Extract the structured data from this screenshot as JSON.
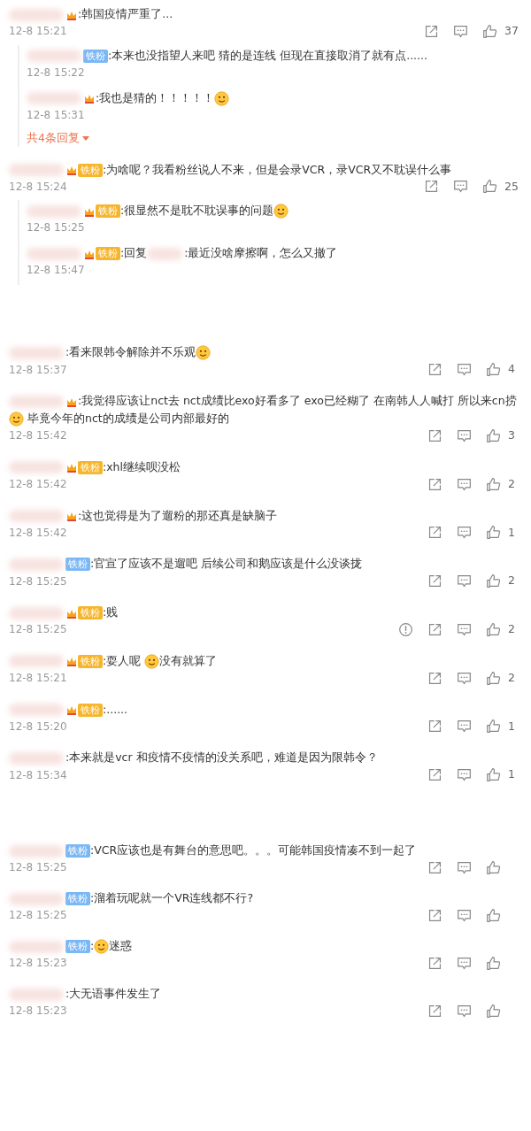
{
  "comments": [
    {
      "badge": {
        "kind": "crown"
      },
      "parts": [
        {
          "kind": "text",
          "text": ":韩国疫情严重了..."
        }
      ],
      "time": "12-8 15:21",
      "likes": "37",
      "replies": [
        {
          "badge": {
            "kind": "blue",
            "label": "铁粉"
          },
          "parts": [
            {
              "kind": "text",
              "text": ":本来也没指望人来吧 猜的是连线 但现在直接取消了就有点......"
            }
          ],
          "time": "12-8 15:22"
        },
        {
          "badge": {
            "kind": "crown"
          },
          "parts": [
            {
              "kind": "text",
              "text": ":我也是猜的！！！！！"
            },
            {
              "kind": "emoji"
            }
          ],
          "time": "12-8 15:31"
        }
      ],
      "more_link": "共4条回复"
    },
    {
      "badge": {
        "kind": "gold",
        "label": "铁粉"
      },
      "parts": [
        {
          "kind": "text",
          "text": ":为啥呢？我看粉丝说人不来，但是会录VCR，录VCR又不耽误什么事"
        }
      ],
      "time": "12-8 15:24",
      "likes": "25",
      "replies": [
        {
          "badge": {
            "kind": "gold",
            "label": "铁粉"
          },
          "parts": [
            {
              "kind": "text",
              "text": ":很显然不是耽不耽误事的问题"
            },
            {
              "kind": "emoji"
            }
          ],
          "time": "12-8 15:25"
        },
        {
          "badge": {
            "kind": "gold",
            "label": "铁粉"
          },
          "parts": [
            {
              "kind": "text",
              "text": ":回复"
            },
            {
              "kind": "hidden"
            },
            {
              "kind": "text",
              "text": ":最近没啥摩擦啊，怎么又撤了"
            }
          ],
          "time": "12-8 15:47"
        }
      ]
    },
    {
      "parts": [
        {
          "kind": "text",
          "text": ":看来限韩令解除并不乐观"
        },
        {
          "kind": "emoji"
        }
      ],
      "time": "12-8 15:37",
      "likes": "4"
    },
    {
      "badge": {
        "kind": "crown"
      },
      "parts": [
        {
          "kind": "text",
          "text": ":我觉得应该让nct去 nct成绩比exo好看多了 exo已经糊了 在南韩人人喊打 所以来cn捞"
        },
        {
          "kind": "emoji"
        },
        {
          "kind": "text",
          "text": " 毕竟今年的nct的成绩是公司内部最好的"
        }
      ],
      "time": "12-8 15:42",
      "likes": "3"
    },
    {
      "badge": {
        "kind": "gold",
        "label": "铁粉"
      },
      "parts": [
        {
          "kind": "text",
          "text": ":xhl继续呗没松"
        }
      ],
      "time": "12-8 15:42",
      "likes": "2"
    },
    {
      "badge": {
        "kind": "crown"
      },
      "parts": [
        {
          "kind": "text",
          "text": ":这也觉得是为了遛粉的那还真是缺脑子"
        }
      ],
      "time": "12-8 15:42",
      "likes": "1"
    },
    {
      "badge": {
        "kind": "blue",
        "label": "铁粉"
      },
      "parts": [
        {
          "kind": "text",
          "text": ":官宣了应该不是遛吧 后续公司和鹅应该是什么没谈拢"
        }
      ],
      "time": "12-8 15:25",
      "likes": "2"
    },
    {
      "badge": {
        "kind": "gold",
        "label": "铁粉"
      },
      "parts": [
        {
          "kind": "text",
          "text": ":贱"
        }
      ],
      "time": "12-8 15:25",
      "likes": "2",
      "report": true
    },
    {
      "badge": {
        "kind": "gold",
        "label": "铁粉"
      },
      "parts": [
        {
          "kind": "text",
          "text": ":耍人呢 "
        },
        {
          "kind": "emoji"
        },
        {
          "kind": "text",
          "text": "没有就算了"
        }
      ],
      "time": "12-8 15:21",
      "likes": "2"
    },
    {
      "badge": {
        "kind": "gold",
        "label": "铁粉"
      },
      "parts": [
        {
          "kind": "text",
          "text": ":......"
        }
      ],
      "time": "12-8 15:20",
      "likes": "1"
    },
    {
      "parts": [
        {
          "kind": "text",
          "text": ":本来就是vcr 和疫情不疫情的没关系吧，难道是因为限韩令？"
        }
      ],
      "time": "12-8 15:34",
      "likes": "1"
    },
    {
      "badge": {
        "kind": "blue",
        "label": "铁粉"
      },
      "parts": [
        {
          "kind": "text",
          "text": ":VCR应该也是有舞台的意思吧。。。可能韩国疫情凑不到一起了"
        }
      ],
      "time": "12-8 15:25"
    },
    {
      "badge": {
        "kind": "blue",
        "label": "铁粉"
      },
      "parts": [
        {
          "kind": "text",
          "text": ":溜着玩呢就一个VR连线都不行?"
        }
      ],
      "time": "12-8 15:25"
    },
    {
      "badge": {
        "kind": "blue",
        "label": "铁粉"
      },
      "parts": [
        {
          "kind": "text",
          "text": ":"
        },
        {
          "kind": "emoji"
        },
        {
          "kind": "text",
          "text": "迷惑"
        }
      ],
      "time": "12-8 15:23"
    },
    {
      "parts": [
        {
          "kind": "text",
          "text": ":大无语事件发生了"
        }
      ],
      "time": "12-8 15:23"
    }
  ]
}
